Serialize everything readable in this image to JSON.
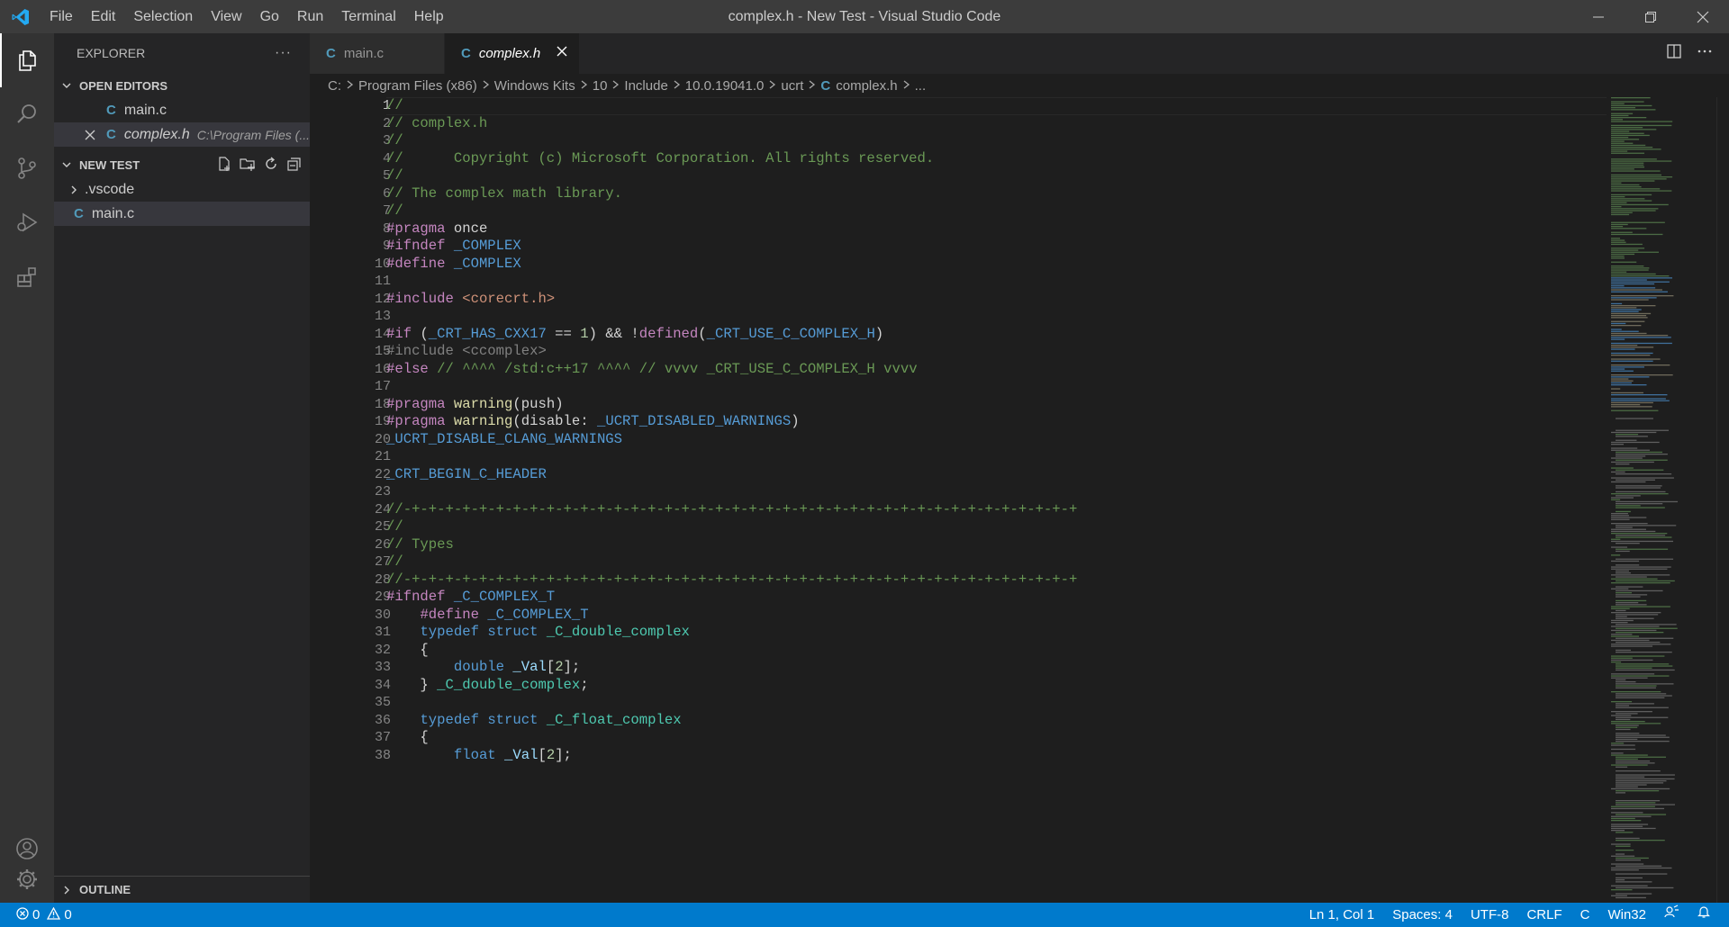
{
  "window": {
    "title": "complex.h - New Test - Visual Studio Code"
  },
  "menu": [
    "File",
    "Edit",
    "Selection",
    "View",
    "Go",
    "Run",
    "Terminal",
    "Help"
  ],
  "sidebar": {
    "title": "EXPLORER",
    "more": "···",
    "open_editors": {
      "label": "OPEN EDITORS",
      "items": [
        {
          "name": "main.c",
          "desc": ""
        },
        {
          "name": "complex.h",
          "desc": "C:\\Program Files (..."
        }
      ]
    },
    "folder": {
      "label": "NEW TEST",
      "items": [
        {
          "name": ".vscode",
          "type": "folder"
        },
        {
          "name": "main.c",
          "type": "file"
        }
      ]
    },
    "outline": "OUTLINE"
  },
  "tabs": [
    {
      "label": "main.c",
      "active": false
    },
    {
      "label": "complex.h",
      "active": true
    }
  ],
  "breadcrumb": [
    "C:",
    "Program Files (x86)",
    "Windows Kits",
    "10",
    "Include",
    "10.0.19041.0",
    "ucrt",
    "complex.h",
    "..."
  ],
  "editor": {
    "current_line": 1,
    "lines": [
      [
        [
          "//",
          "c"
        ]
      ],
      [
        [
          "// complex.h",
          "c"
        ]
      ],
      [
        [
          "//",
          "c"
        ]
      ],
      [
        [
          "//      Copyright (c) Microsoft Corporation. All rights reserved.",
          "c"
        ]
      ],
      [
        [
          "//",
          "c"
        ]
      ],
      [
        [
          "// The complex math library.",
          "c"
        ]
      ],
      [
        [
          "//",
          "c"
        ]
      ],
      [
        [
          "#pragma ",
          "pp"
        ],
        [
          "once",
          "w"
        ]
      ],
      [
        [
          "#ifndef ",
          "pp"
        ],
        [
          "_COMPLEX",
          "m"
        ]
      ],
      [
        [
          "#define ",
          "pp"
        ],
        [
          "_COMPLEX",
          "m"
        ]
      ],
      [],
      [
        [
          "#include ",
          "pp"
        ],
        [
          "<corecrt.h>",
          "s"
        ]
      ],
      [],
      [
        [
          "#if ",
          "pp"
        ],
        [
          "(",
          "w"
        ],
        [
          "_CRT_HAS_CXX17",
          "m"
        ],
        [
          " == ",
          "w"
        ],
        [
          "1",
          "n"
        ],
        [
          ") && !",
          "w"
        ],
        [
          "defined",
          "pp"
        ],
        [
          "(",
          "w"
        ],
        [
          "_CRT_USE_C_COMPLEX_H",
          "m"
        ],
        [
          ")",
          "w"
        ]
      ],
      [
        [
          "#include <ccomplex>",
          "d"
        ]
      ],
      [
        [
          "#else ",
          "pp"
        ],
        [
          "// ^^^^ /std:c++17 ^^^^ // vvvv _CRT_USE_C_COMPLEX_H vvvv",
          "c"
        ]
      ],
      [],
      [
        [
          "#pragma ",
          "pp"
        ],
        [
          "warning",
          "f"
        ],
        [
          "(",
          "w"
        ],
        [
          "push",
          "w"
        ],
        [
          ")",
          "w"
        ]
      ],
      [
        [
          "#pragma ",
          "pp"
        ],
        [
          "warning",
          "f"
        ],
        [
          "(",
          "w"
        ],
        [
          "disable: ",
          "w"
        ],
        [
          "_UCRT_DISABLED_WARNINGS",
          "m"
        ],
        [
          ")",
          "w"
        ]
      ],
      [
        [
          "_UCRT_DISABLE_CLANG_WARNINGS",
          "m"
        ]
      ],
      [],
      [
        [
          "_CRT_BEGIN_C_HEADER",
          "m"
        ]
      ],
      [],
      [
        [
          "//-+-+-+-+-+-+-+-+-+-+-+-+-+-+-+-+-+-+-+-+-+-+-+-+-+-+-+-+-+-+-+-+-+-+-+-+-+-+-+-+",
          "c"
        ]
      ],
      [
        [
          "//",
          "c"
        ]
      ],
      [
        [
          "// Types",
          "c"
        ]
      ],
      [
        [
          "//",
          "c"
        ]
      ],
      [
        [
          "//-+-+-+-+-+-+-+-+-+-+-+-+-+-+-+-+-+-+-+-+-+-+-+-+-+-+-+-+-+-+-+-+-+-+-+-+-+-+-+-+",
          "c"
        ]
      ],
      [
        [
          "#ifndef ",
          "pp"
        ],
        [
          "_C_COMPLEX_T",
          "m"
        ]
      ],
      [
        [
          "    ",
          "w"
        ],
        [
          "#define ",
          "pp"
        ],
        [
          "_C_COMPLEX_T",
          "m"
        ]
      ],
      [
        [
          "    ",
          "w"
        ],
        [
          "typedef ",
          "kw"
        ],
        [
          "struct ",
          "kw"
        ],
        [
          "_C_double_complex",
          "i"
        ]
      ],
      [
        [
          "    {",
          "w"
        ]
      ],
      [
        [
          "        ",
          "w"
        ],
        [
          "double ",
          "kw"
        ],
        [
          "_Val",
          "v"
        ],
        [
          "[",
          "w"
        ],
        [
          "2",
          "n"
        ],
        [
          "];",
          "w"
        ]
      ],
      [
        [
          "    } ",
          "w"
        ],
        [
          "_C_double_complex",
          "i"
        ],
        [
          ";",
          "w"
        ]
      ],
      [],
      [
        [
          "    ",
          "w"
        ],
        [
          "typedef ",
          "kw"
        ],
        [
          "struct ",
          "kw"
        ],
        [
          "_C_float_complex",
          "i"
        ]
      ],
      [
        [
          "    {",
          "w"
        ]
      ],
      [
        [
          "        ",
          "w"
        ],
        [
          "float ",
          "kw"
        ],
        [
          "_Val",
          "v"
        ],
        [
          "[",
          "w"
        ],
        [
          "2",
          "n"
        ],
        [
          "];",
          "w"
        ]
      ]
    ]
  },
  "statusbar": {
    "errors": "0",
    "warnings": "0",
    "position": "Ln 1, Col 1",
    "spaces": "Spaces: 4",
    "encoding": "UTF-8",
    "eol": "CRLF",
    "language": "C",
    "platform": "Win32"
  },
  "colors": {
    "accent": "#007acc",
    "c_file_icon": "#519aba",
    "vscode_logo": "#23a9f2"
  }
}
